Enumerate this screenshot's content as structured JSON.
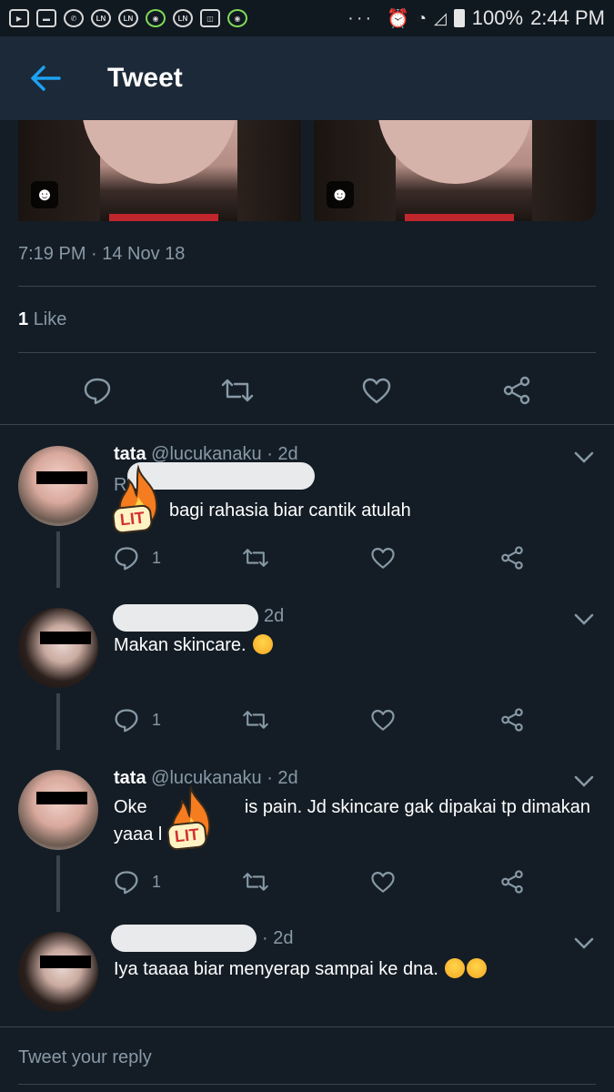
{
  "status_bar": {
    "icons": [
      "youtube-icon",
      "message-icon",
      "whatsapp-icon",
      "line-icon",
      "line-icon",
      "gojek-icon",
      "line-icon",
      "shopping-bag-icon",
      "gojek-icon"
    ],
    "dots": "···",
    "battery": "100%",
    "time": "2:44 PM"
  },
  "header": {
    "title": "Tweet"
  },
  "tweet": {
    "timestamp": "7:19 PM · 14 Nov 18",
    "like_count": "1",
    "like_label": "Like"
  },
  "replies": [
    {
      "name": "tata",
      "handle": "@lucukanaku",
      "time": "· 2d",
      "text": "bagi rahasia biar cantik atulah",
      "prefix": "R",
      "reply_count": "1"
    },
    {
      "name": "",
      "handle": "",
      "time": "2d",
      "text": "Makan skincare.",
      "reply_count": "1"
    },
    {
      "name": "tata",
      "handle": "@lucukanaku",
      "time": "· 2d",
      "text_line1a": "Oke",
      "text_line1b": "is pain. Jd skincare gak dipakai tp dimakan",
      "text_line2": "yaaa l",
      "reply_count": "1"
    },
    {
      "name": "",
      "handle": "",
      "time": "· 2d",
      "text": "Iya taaaa biar menyerap sampai ke dna.",
      "reply_count": ""
    }
  ],
  "stickers": {
    "lit": "LIT"
  },
  "composer": {
    "placeholder": "Tweet your reply"
  },
  "colors": {
    "background": "#141d26",
    "header": "#1c2938",
    "accent": "#1da1f2",
    "muted": "#8899a6",
    "divider": "#38444d"
  }
}
